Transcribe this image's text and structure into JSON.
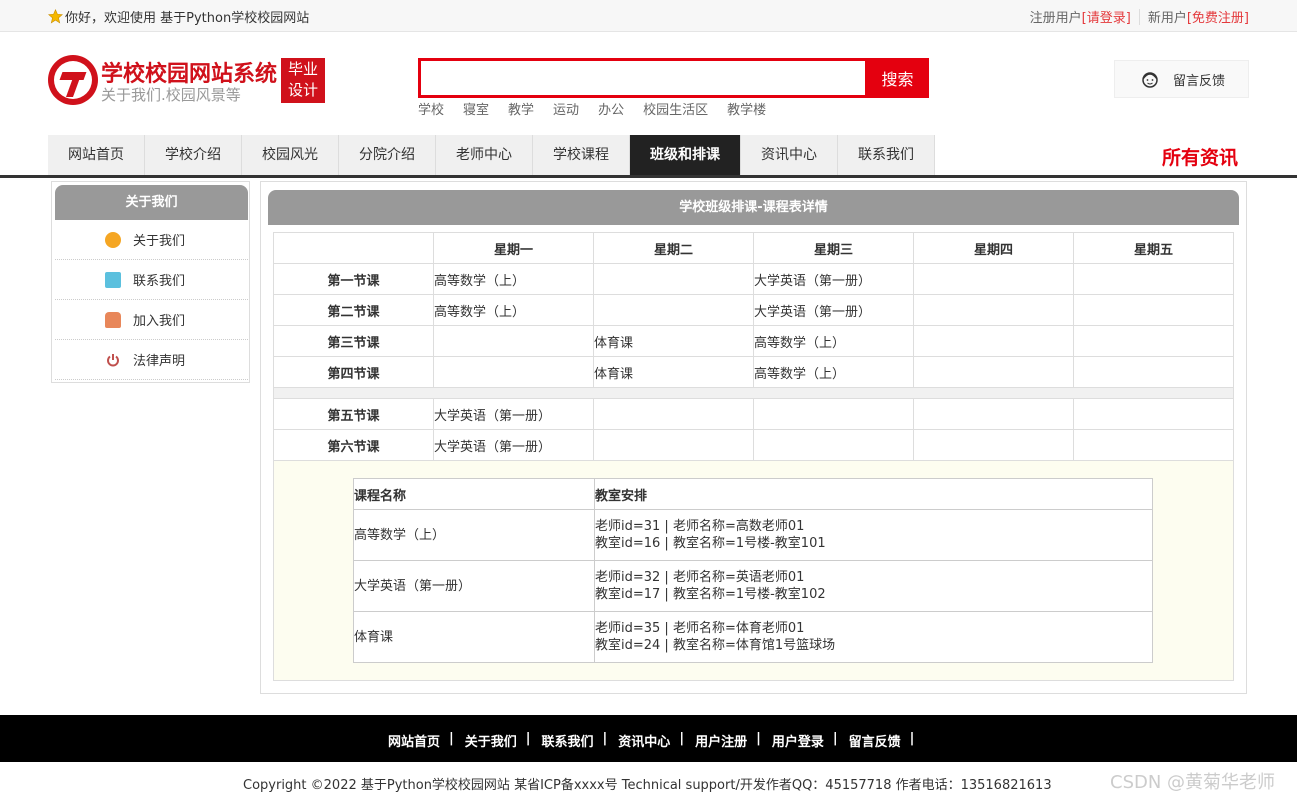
{
  "topbar": {
    "welcome": "你好，欢迎使用 基于Python学校校园网站",
    "register_prefix": "注册用户",
    "login_link": "[请登录]",
    "newuser_prefix": "新用户",
    "register_link": "[免费注册]"
  },
  "header": {
    "title": "学校校园网站系统",
    "subtitle": "关于我们.校园风景等",
    "badge_line1": "毕业",
    "badge_line2": "设计",
    "search_button": "搜索",
    "search_value": "",
    "hotwords": [
      "学校",
      "寝室",
      "教学",
      "运动",
      "办公",
      "校园生活区",
      "教学楼"
    ],
    "feedback_label": "留言反馈"
  },
  "nav": {
    "items": [
      "网站首页",
      "学校介绍",
      "校园风光",
      "分院介绍",
      "老师中心",
      "学校课程",
      "班级和排课",
      "资讯中心",
      "联系我们"
    ],
    "active_index": 6,
    "all_news": "所有资讯"
  },
  "sidebar": {
    "title": "关于我们",
    "items": [
      {
        "label": "关于我们",
        "icon": "orange-circle-icon"
      },
      {
        "label": "联系我们",
        "icon": "clipboard-icon"
      },
      {
        "label": "加入我们",
        "icon": "lock-icon"
      },
      {
        "label": "法律声明",
        "icon": "power-icon"
      }
    ]
  },
  "main": {
    "title": "学校班级排课-课程表详情",
    "days": [
      "星期一",
      "星期二",
      "星期三",
      "星期四",
      "星期五"
    ],
    "morning": [
      {
        "period": "第一节课",
        "cells": [
          "高等数学（上）",
          "",
          "大学英语（第一册）",
          "",
          ""
        ]
      },
      {
        "period": "第二节课",
        "cells": [
          "高等数学（上）",
          "",
          "大学英语（第一册）",
          "",
          ""
        ]
      },
      {
        "period": "第三节课",
        "cells": [
          "",
          "体育课",
          "高等数学（上）",
          "",
          ""
        ]
      },
      {
        "period": "第四节课",
        "cells": [
          "",
          "体育课",
          "高等数学（上）",
          "",
          ""
        ]
      }
    ],
    "afternoon": [
      {
        "period": "第五节课",
        "cells": [
          "大学英语（第一册）",
          "",
          "",
          "",
          ""
        ]
      },
      {
        "period": "第六节课",
        "cells": [
          "大学英语（第一册）",
          "",
          "",
          "",
          ""
        ]
      }
    ],
    "legend_headers": [
      "课程名称",
      "教室安排"
    ],
    "legend_rows": [
      {
        "course": "高等数学（上）",
        "line1": "老师id=31 | 老师名称=高数老师01",
        "line2": "教室id=16 | 教室名称=1号楼-教室101"
      },
      {
        "course": "大学英语（第一册）",
        "line1": "老师id=32 | 老师名称=英语老师01",
        "line2": "教室id=17 | 教室名称=1号楼-教室102"
      },
      {
        "course": "体育课",
        "line1": "老师id=35 | 老师名称=体育老师01",
        "line2": "教室id=24 | 教室名称=体育馆1号篮球场"
      }
    ]
  },
  "footer": {
    "links": [
      "网站首页",
      "关于我们",
      "联系我们",
      "资讯中心",
      "用户注册",
      "用户登录",
      "留言反馈"
    ],
    "copyright": "Copyright ©2022 基于Python学校校园网站 某省ICP备xxxx号    Technical support/开发作者QQ：45157718     作者电话：13516821613",
    "watermark": "CSDN @黄菊华老师"
  }
}
